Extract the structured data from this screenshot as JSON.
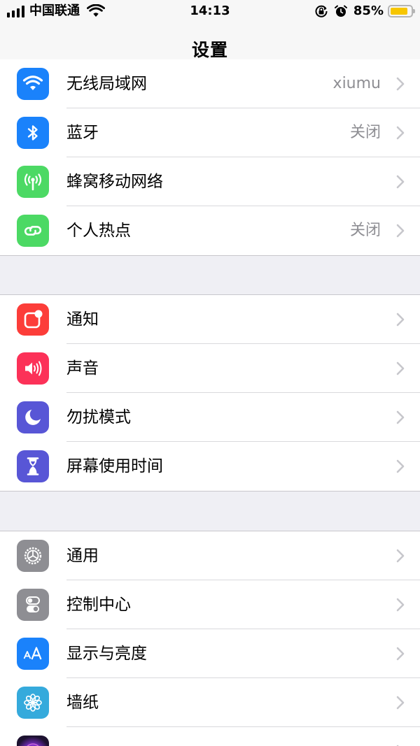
{
  "status_bar": {
    "carrier": "中国联通",
    "time": "14:13",
    "battery": "85%",
    "battery_level": 0.85,
    "battery_color": "#f7c600"
  },
  "nav": {
    "title": "设置"
  },
  "groups": [
    {
      "items": [
        {
          "label": "无线局域网",
          "value": "xiumu",
          "icon": "wifi-icon",
          "color": "#1a82fb"
        },
        {
          "label": "蓝牙",
          "value": "关闭",
          "icon": "bluetooth-icon",
          "color": "#1a82fb"
        },
        {
          "label": "蜂窝移动网络",
          "value": "",
          "icon": "cellular-icon",
          "color": "#4cd964"
        },
        {
          "label": "个人热点",
          "value": "关闭",
          "icon": "hotspot-icon",
          "color": "#4cd964"
        }
      ]
    },
    {
      "items": [
        {
          "label": "通知",
          "value": "",
          "icon": "notification-icon",
          "color": "#fc3d39"
        },
        {
          "label": "声音",
          "value": "",
          "icon": "sound-icon",
          "color": "#fc3158"
        },
        {
          "label": "勿扰模式",
          "value": "",
          "icon": "moon-icon",
          "color": "#5856d6"
        },
        {
          "label": "屏幕使用时间",
          "value": "",
          "icon": "hourglass-icon",
          "color": "#5856d6"
        }
      ]
    },
    {
      "items": [
        {
          "label": "通用",
          "value": "",
          "icon": "gear-icon",
          "color": "#8e8e93"
        },
        {
          "label": "控制中心",
          "value": "",
          "icon": "toggle-icon",
          "color": "#8e8e93"
        },
        {
          "label": "显示与亮度",
          "value": "",
          "icon": "text-size-icon",
          "color": "#1a82fb"
        },
        {
          "label": "墙纸",
          "value": "",
          "icon": "flower-icon",
          "color": "#35aadc"
        },
        {
          "label": "",
          "value": "",
          "icon": "siri-icon",
          "color": "#2a1b3d"
        }
      ]
    }
  ]
}
